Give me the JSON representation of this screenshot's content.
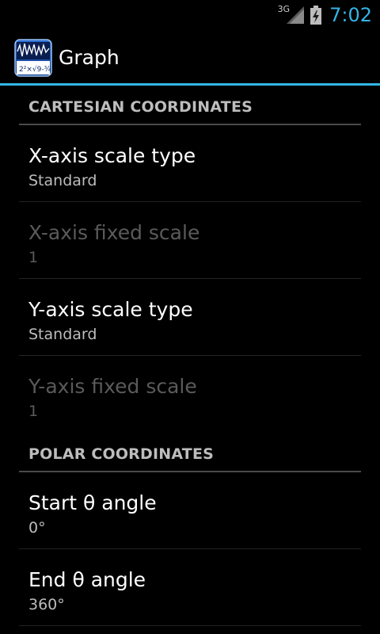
{
  "status_bar": {
    "network_type": "3G",
    "time": "7:02",
    "icons": [
      "signal-icon",
      "battery-charging-icon"
    ]
  },
  "action_bar": {
    "title": "Graph",
    "icon": "graph-app-icon"
  },
  "sections": [
    {
      "header": "CARTESIAN COORDINATES",
      "items": [
        {
          "title": "X-axis scale type",
          "summary": "Standard",
          "enabled": true
        },
        {
          "title": "X-axis fixed scale",
          "summary": "1",
          "enabled": false
        },
        {
          "title": "Y-axis scale type",
          "summary": "Standard",
          "enabled": true
        },
        {
          "title": "Y-axis fixed scale",
          "summary": "1",
          "enabled": false
        }
      ]
    },
    {
      "header": "POLAR COORDINATES",
      "items": [
        {
          "title": "Start θ angle",
          "summary": "0°",
          "enabled": true
        },
        {
          "title": "End θ angle",
          "summary": "360°",
          "enabled": true
        }
      ]
    }
  ],
  "colors": {
    "accent": "#33b5e5",
    "background": "#000000"
  }
}
